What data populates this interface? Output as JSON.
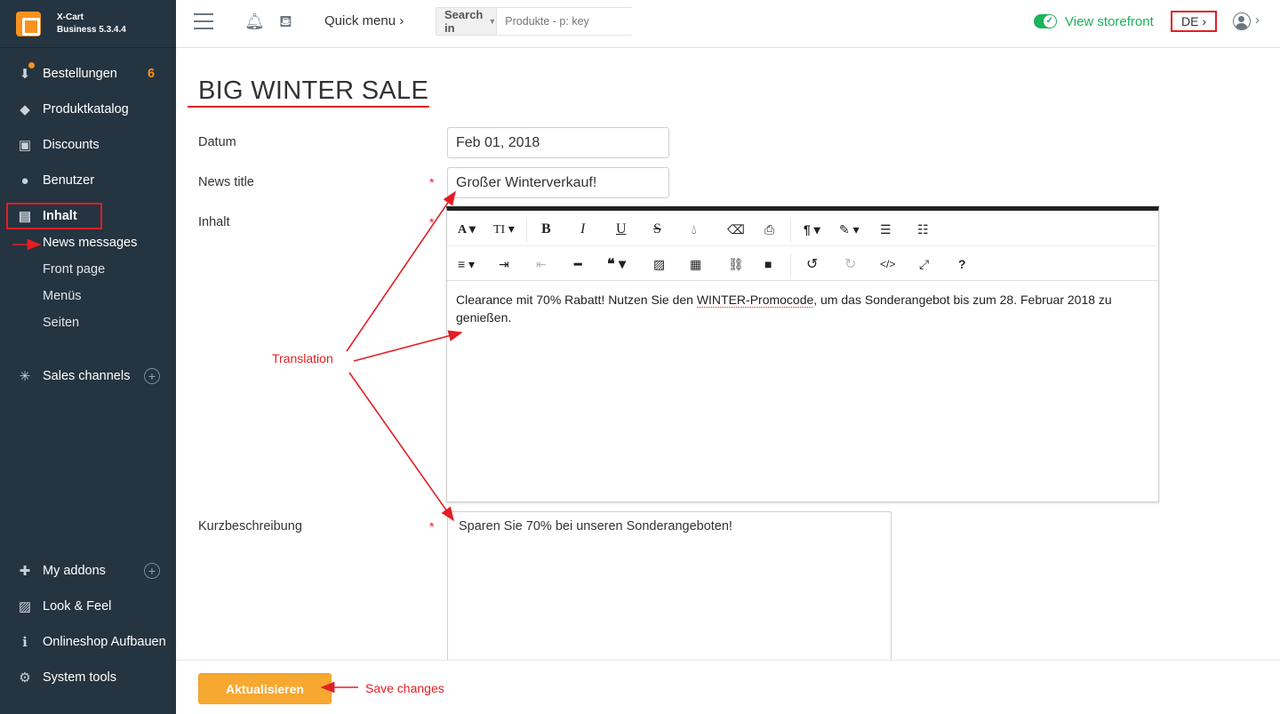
{
  "app": {
    "name": "X-Cart",
    "version": "Business 5.3.4.4"
  },
  "sidebar": {
    "items": [
      {
        "label": "Bestellungen",
        "icon": "orders-icon",
        "count": "6"
      },
      {
        "label": "Produktkatalog",
        "icon": "tags-icon"
      },
      {
        "label": "Discounts",
        "icon": "gift-icon"
      },
      {
        "label": "Benutzer",
        "icon": "users-icon"
      },
      {
        "label": "Inhalt",
        "icon": "content-icon",
        "active": true
      },
      {
        "label": "Sales channels",
        "icon": "network-icon"
      },
      {
        "label": "My addons",
        "icon": "puzzle-icon"
      },
      {
        "label": "Look & Feel",
        "icon": "image-icon"
      },
      {
        "label": "Onlineshop Aufbauen",
        "icon": "info-icon"
      },
      {
        "label": "System tools",
        "icon": "gear-icon"
      }
    ],
    "subitems": [
      "News messages",
      "Front page",
      "Menüs",
      "Seiten"
    ]
  },
  "topbar": {
    "quick_menu": "Quick menu",
    "search_in": "Search in",
    "search_placeholder": "Produkte - p: key",
    "view_storefront": "View storefront",
    "language": "DE"
  },
  "page": {
    "title": "BIG WINTER SALE"
  },
  "form": {
    "date_label": "Datum",
    "date_value": "Feb 01, 2018",
    "news_title_label": "News title",
    "news_title_value": "Großer Winterverkauf!",
    "content_label": "Inhalt",
    "content_text_before": "Clearance mit 70% Rabatt! Nutzen Sie den ",
    "content_text_spell": "WINTER-Promocode",
    "content_text_after": ", um das Sonderangebot bis zum 28. Februar 2018 zu genießen.",
    "brief_label": "Kurzbeschreibung",
    "brief_value": "Sparen Sie 70% bei unseren Sonderangeboten!",
    "required_mark": "*"
  },
  "footer": {
    "save_label": "Aktualisieren"
  },
  "annotations": {
    "translation": "Translation",
    "save_changes": "Save changes"
  },
  "colors": {
    "sidebar_bg": "#243440",
    "accent_orange": "#f7931e",
    "storefront_green": "#1bb35b",
    "annotation_red": "#e31e24"
  }
}
